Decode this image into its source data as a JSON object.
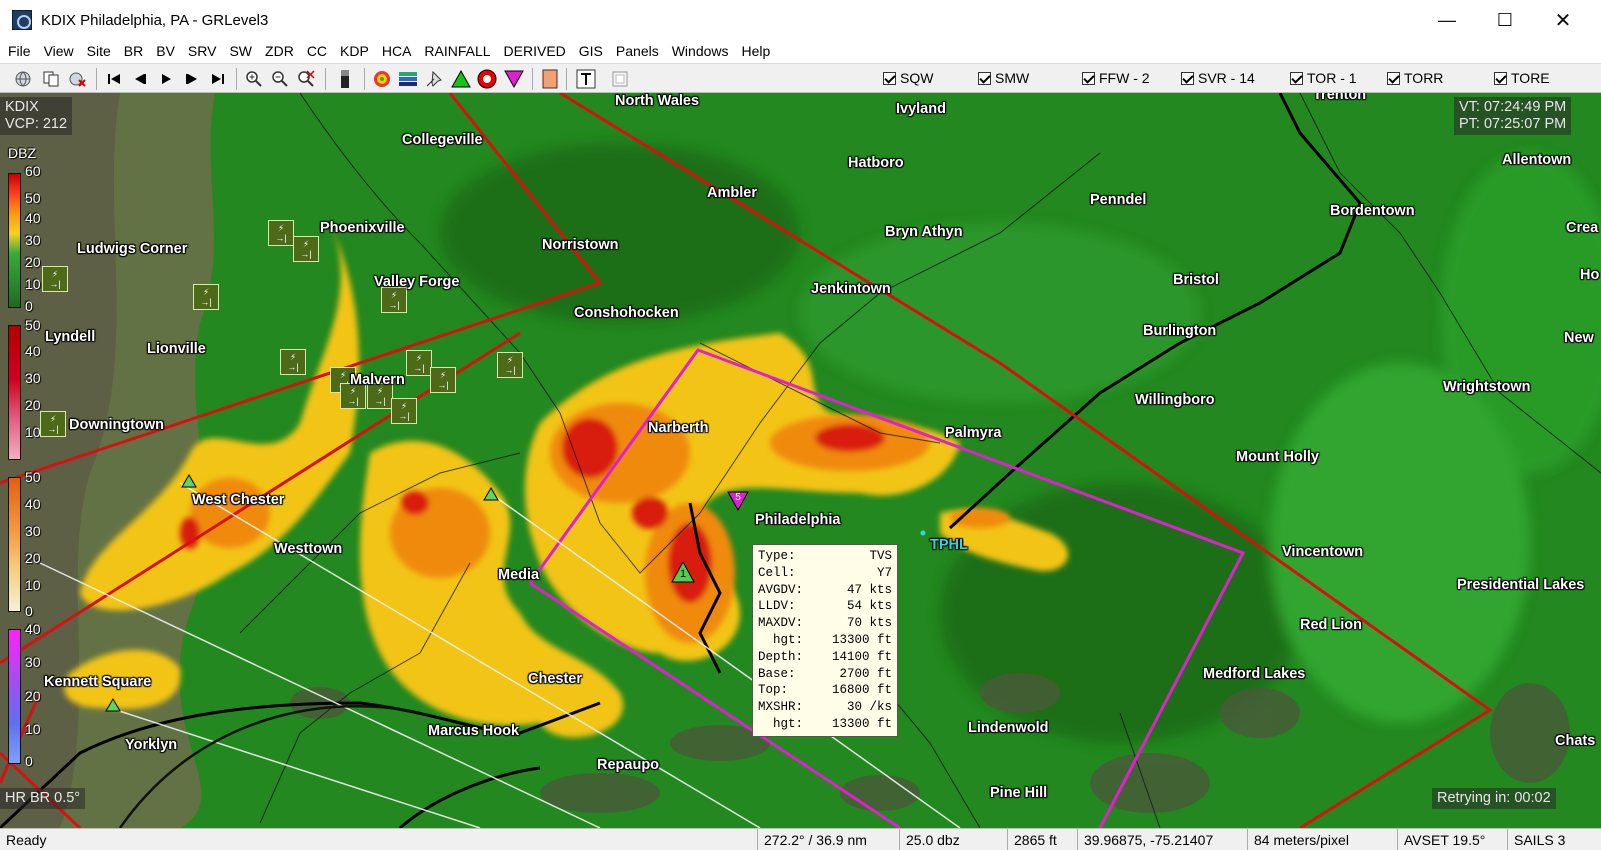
{
  "window": {
    "title": "KDIX Philadelphia, PA - GRLevel3",
    "min_glyph": "—",
    "max_glyph": "☐",
    "close_glyph": "✕"
  },
  "menu": [
    "File",
    "View",
    "Site",
    "BR",
    "BV",
    "SRV",
    "SW",
    "ZDR",
    "CC",
    "KDP",
    "HCA",
    "RAINFALL",
    "DERIVED",
    "GIS",
    "Panels",
    "Windows",
    "Help"
  ],
  "toolbar": {
    "icons": [
      "globe-icon",
      "copy-icon",
      "globe-refresh-icon",
      "skip-back-icon",
      "step-back-icon",
      "play-icon",
      "step-forward-icon",
      "skip-forward-icon",
      "zoom-in-icon",
      "zoom-out-icon",
      "zoom-reset-icon",
      "color-bar-icon",
      "storm-icon",
      "layers-icon",
      "pin-icon",
      "tvs-triangle-icon",
      "meso-circle-icon",
      "hail-triangle-icon",
      "palette-icon",
      "text-icon",
      "frame-icon"
    ],
    "warnings": [
      {
        "label": "SQW",
        "checked": true
      },
      {
        "label": "SMW",
        "checked": true
      },
      {
        "label": "FFW - 2",
        "checked": true
      },
      {
        "label": "SVR - 14",
        "checked": true
      },
      {
        "label": "TOR - 1",
        "checked": true
      },
      {
        "label": "TORR",
        "checked": true
      },
      {
        "label": "TORE",
        "checked": true
      }
    ]
  },
  "map": {
    "site": "KDIX",
    "vcp": "VCP: 212",
    "vt": "VT: 07:24:49 PM",
    "pt": "PT: 07:25:07 PM",
    "product": "HR BR 0.5°",
    "retry": "Retrying in: 00:02",
    "legend_title": "DBZ",
    "legend_ticks": [
      {
        "group": 1,
        "labels": [
          "60",
          "50",
          "40",
          "30",
          "20",
          "10",
          "0"
        ]
      },
      {
        "group": 2,
        "labels": [
          "50",
          "40",
          "30",
          "20",
          "10"
        ]
      },
      {
        "group": 3,
        "labels": [
          "50",
          "40",
          "30",
          "20",
          "10",
          "0"
        ]
      },
      {
        "group": 4,
        "labels": [
          "40",
          "30",
          "20",
          "10",
          "0"
        ]
      }
    ],
    "cities": [
      {
        "name": "North Wales"
      },
      {
        "name": "Ivyland"
      },
      {
        "name": "Trenton"
      },
      {
        "name": "Collegeville"
      },
      {
        "name": "Hatboro"
      },
      {
        "name": "Allentown"
      },
      {
        "name": "Ambler"
      },
      {
        "name": "Penndel"
      },
      {
        "name": "Bordentown"
      },
      {
        "name": "Crea"
      },
      {
        "name": "Phoenixville"
      },
      {
        "name": "Norristown"
      },
      {
        "name": "Bryn Athyn"
      },
      {
        "name": "Ludwigs Corner"
      },
      {
        "name": "Ho"
      },
      {
        "name": "Valley Forge"
      },
      {
        "name": "Jenkintown"
      },
      {
        "name": "Bristol"
      },
      {
        "name": "Conshohocken"
      },
      {
        "name": "Burlington"
      },
      {
        "name": "Lyndell"
      },
      {
        "name": "New"
      },
      {
        "name": "Lionville"
      },
      {
        "name": "Wrightstown"
      },
      {
        "name": "Willingboro"
      },
      {
        "name": "Malvern"
      },
      {
        "name": "Downingtown"
      },
      {
        "name": "Narberth"
      },
      {
        "name": "Palmyra"
      },
      {
        "name": "Mount Holly"
      },
      {
        "name": "West Chester"
      },
      {
        "name": "Philadelphia"
      },
      {
        "name": "TPHL"
      },
      {
        "name": "Westtown"
      },
      {
        "name": "Vincentown"
      },
      {
        "name": "Media"
      },
      {
        "name": "Presidential Lakes"
      },
      {
        "name": "Red Lion"
      },
      {
        "name": "Kennett Square"
      },
      {
        "name": "Chester"
      },
      {
        "name": "Medford Lakes"
      },
      {
        "name": "Yorklyn"
      },
      {
        "name": "Marcus Hook"
      },
      {
        "name": "Lindenwold"
      },
      {
        "name": "Chats"
      },
      {
        "name": "Repaupo"
      },
      {
        "name": "Pine Hill"
      }
    ],
    "markers": {
      "tvs": "1",
      "hail": "5"
    },
    "tooltip": [
      {
        "k": "Type:",
        "v": "TVS"
      },
      {
        "k": "Cell:",
        "v": "Y7"
      },
      {
        "k": "AVGDV:",
        "v": "47 kts"
      },
      {
        "k": "LLDV:",
        "v": "54 kts"
      },
      {
        "k": "MAXDV:",
        "v": "70 kts"
      },
      {
        "k": "  hgt:",
        "v": "13300 ft"
      },
      {
        "k": "Depth:",
        "v": "14100 ft"
      },
      {
        "k": "Base:",
        "v": "2700 ft"
      },
      {
        "k": "Top:",
        "v": "16800 ft"
      },
      {
        "k": "MXSHR:",
        "v": "30 /ks"
      },
      {
        "k": "  hgt:",
        "v": "13300 ft"
      }
    ]
  },
  "status": {
    "ready": "Ready",
    "azimuth": "272.2° / 36.9 nm",
    "value": "25.0 dbz",
    "height": "2865 ft",
    "coords": "39.96875, -75.21407",
    "scale": "84 meters/pixel",
    "avset": "AVSET 19.5°",
    "sails": "SAILS 3"
  }
}
